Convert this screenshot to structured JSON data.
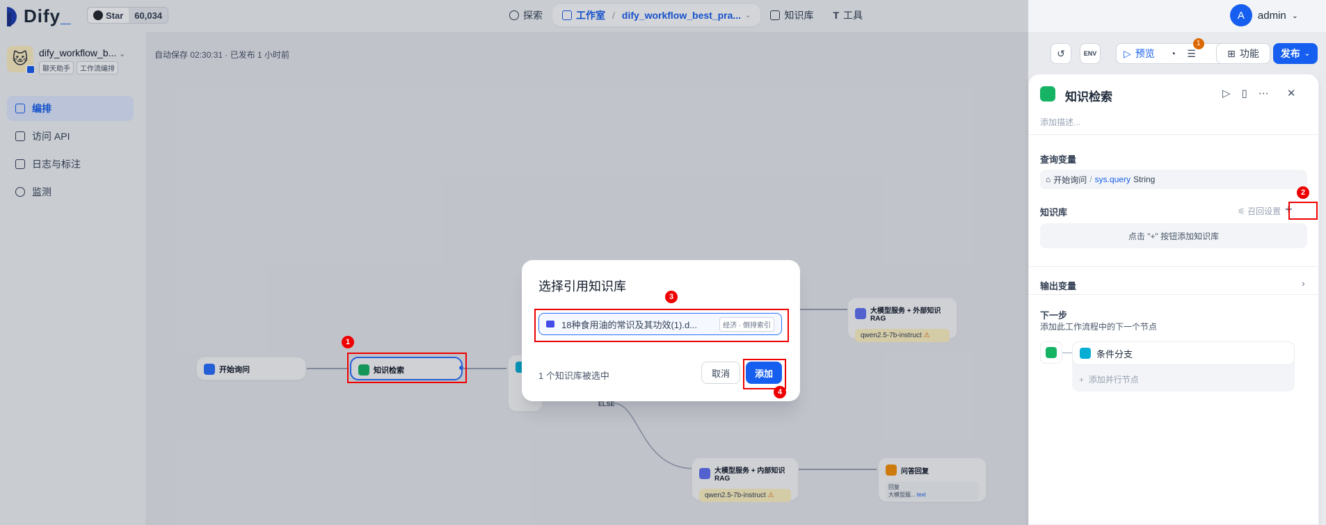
{
  "brand": {
    "name": "Dify",
    "github_star": "Star",
    "github_count": "60,034"
  },
  "nav": {
    "explore": "探索",
    "studio": "工作室",
    "workflow": "dify_workflow_best_pra...",
    "knowledge": "知识库",
    "tools": "工具"
  },
  "user": {
    "initial": "A",
    "name": "admin"
  },
  "app": {
    "name": "dify_workflow_b...",
    "tag1": "聊天助手",
    "tag2": "工作流编排"
  },
  "sidebar": {
    "items": [
      {
        "label": "编排"
      },
      {
        "label": "访问 API"
      },
      {
        "label": "日志与标注"
      },
      {
        "label": "监测"
      }
    ]
  },
  "toolbar": {
    "autosave": "自动保存 02:30:31 · 已发布 1 小时前",
    "env": "ENV",
    "preview": "预览",
    "badge": "1",
    "features": "功能",
    "publish": "发布"
  },
  "nodes": {
    "start": "开始询问",
    "knowledge": "知识检索",
    "llm_external": "大模型服务 + 外部知识RAG",
    "llm_external_model": "qwen2.5-7b-instruct",
    "else": "ELSE",
    "llm_internal": "大模型服务 + 内部知识RAG",
    "llm_internal_model": "qwen2.5-7b-instruct",
    "answer": "问答回复",
    "answer_label": "回复",
    "answer_var": "大模型服...",
    "answer_type": "text"
  },
  "panel": {
    "title": "知识检索",
    "desc": "添加描述...",
    "query_title": "查询变量",
    "query_source": "开始询问",
    "query_var": "sys.query",
    "query_type": "String",
    "kb_title": "知识库",
    "recall": "召回设置",
    "kb_empty": "点击 \"+\" 按钮添加知识库",
    "output_title": "输出变量",
    "next_title": "下一步",
    "next_desc": "添加此工作流程中的下一个节点",
    "next_node": "条件分支",
    "add_parallel": "添加并行节点"
  },
  "modal": {
    "title": "选择引用知识库",
    "kb_name": "18种食用油的常识及其功效(1).d...",
    "kb_tag": "经济 · 倒排索引",
    "selected": "1 个知识库被选中",
    "cancel": "取消",
    "add": "添加"
  },
  "annotations": [
    "1",
    "2",
    "3",
    "4"
  ]
}
